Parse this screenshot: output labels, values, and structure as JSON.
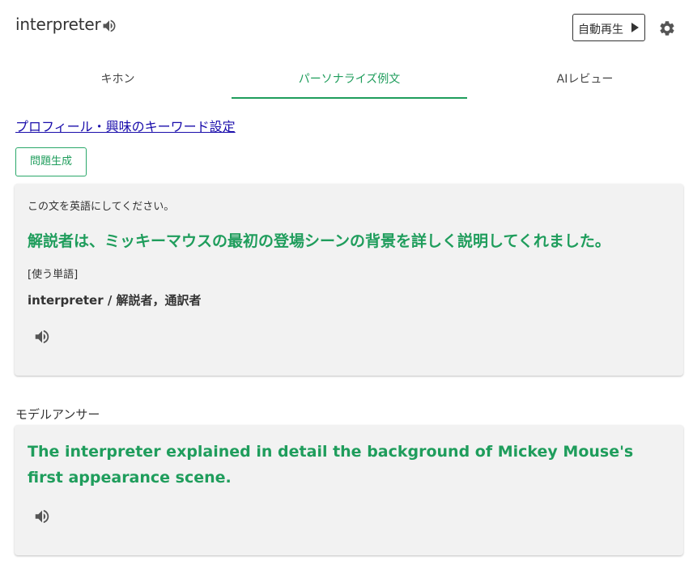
{
  "header": {
    "word": "interpreter",
    "autoplay_label": "自動再生",
    "icons": {
      "speaker": "speaker-icon",
      "play": "play-icon",
      "settings": "gear-icon"
    }
  },
  "tabs": [
    {
      "label": "キホン",
      "active": false
    },
    {
      "label": "パーソナライズ例文",
      "active": true
    },
    {
      "label": "AIレビュー",
      "active": false
    }
  ],
  "profile_link": "プロフィール・興味のキーワード設定",
  "generate_button": "問題生成",
  "question_card": {
    "instruction": "この文を英語にしてください。",
    "sentence": "解説者は、ミッキーマウスの最初の登場シーンの背景を詳しく説明してくれました。",
    "use_word_label": "[使う単語]",
    "word_meaning": "interpreter / 解説者，通訳者"
  },
  "model_answer": {
    "label": "モデルアンサー",
    "sentence": "The interpreter explained in detail the background of Mickey Mouse's first appearance scene."
  },
  "colors": {
    "accent": "#1f9d5c",
    "link": "#1a0dab",
    "card_bg": "#f2f2f2",
    "text": "#333333"
  }
}
